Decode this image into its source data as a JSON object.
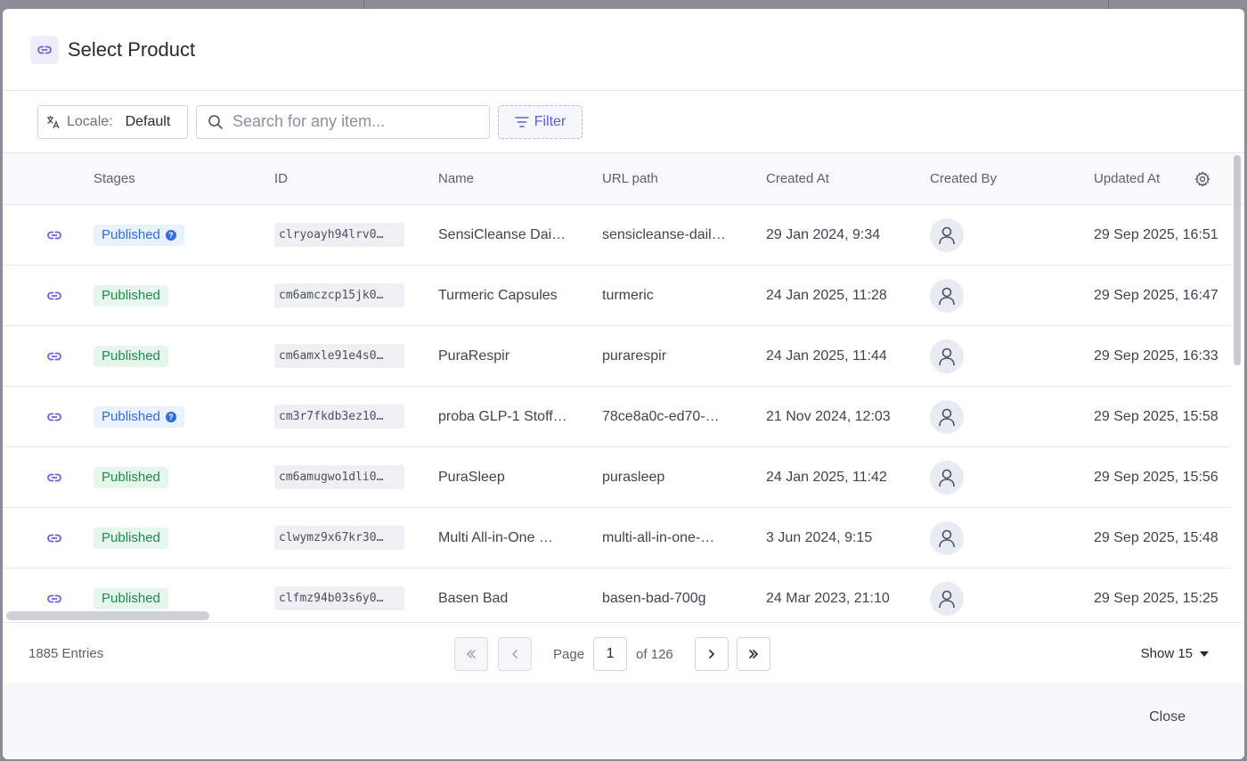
{
  "dialog": {
    "title": "Select Product"
  },
  "toolbar": {
    "locale_label": "Locale:",
    "locale_value": "Default",
    "search_placeholder": "Search for any item...",
    "filter_label": "Filter"
  },
  "table": {
    "columns": [
      "Stages",
      "ID",
      "Name",
      "URL path",
      "Created At",
      "Created By",
      "Updated At"
    ],
    "rows": [
      {
        "stage": "Published",
        "stage_variant": "blue",
        "id": "clryoayh94lrv0…",
        "name": "SensiCleanse Dai…",
        "url": "sensicleanse-dail…",
        "created_at": "29 Jan 2024, 9:34",
        "updated_at": "29 Sep 2025, 16:51"
      },
      {
        "stage": "Published",
        "stage_variant": "green",
        "id": "cm6amczcp15jk0…",
        "name": "Turmeric Capsules",
        "url": "turmeric",
        "created_at": "24 Jan 2025, 11:28",
        "updated_at": "29 Sep 2025, 16:47"
      },
      {
        "stage": "Published",
        "stage_variant": "green",
        "id": "cm6amxle91e4s0…",
        "name": "PuraRespir",
        "url": "purarespir",
        "created_at": "24 Jan 2025, 11:44",
        "updated_at": "29 Sep 2025, 16:33"
      },
      {
        "stage": "Published",
        "stage_variant": "blue",
        "id": "cm3r7fkdb3ez10…",
        "name": "proba GLP-1 Stoff…",
        "url": "78ce8a0c-ed70-…",
        "created_at": "21 Nov 2024, 12:03",
        "updated_at": "29 Sep 2025, 15:58"
      },
      {
        "stage": "Published",
        "stage_variant": "green",
        "id": "cm6amugwo1dli0…",
        "name": "PuraSleep",
        "url": "purasleep",
        "created_at": "24 Jan 2025, 11:42",
        "updated_at": "29 Sep 2025, 15:56"
      },
      {
        "stage": "Published",
        "stage_variant": "green",
        "id": "clwymz9x67kr30…",
        "name": "Multi All-in-One …",
        "url": "multi-all-in-one-…",
        "created_at": "3 Jun 2024, 9:15",
        "updated_at": "29 Sep 2025, 15:48"
      },
      {
        "stage": "Published",
        "stage_variant": "green",
        "id": "clfmz94b03s6y0…",
        "name": "Basen Bad",
        "url": "basen-bad-700g",
        "created_at": "24 Mar 2023, 21:10",
        "updated_at": "29 Sep 2025, 15:25"
      }
    ]
  },
  "footer": {
    "entries": "1885 Entries",
    "page_label": "Page",
    "page_value": "1",
    "of_label": "of 126",
    "show_label": "Show 15"
  },
  "actions": {
    "close_label": "Close"
  },
  "colors": {
    "accent": "#5b5fd6",
    "published_blue": "#2f6fd6",
    "published_green": "#1f8a4c"
  }
}
